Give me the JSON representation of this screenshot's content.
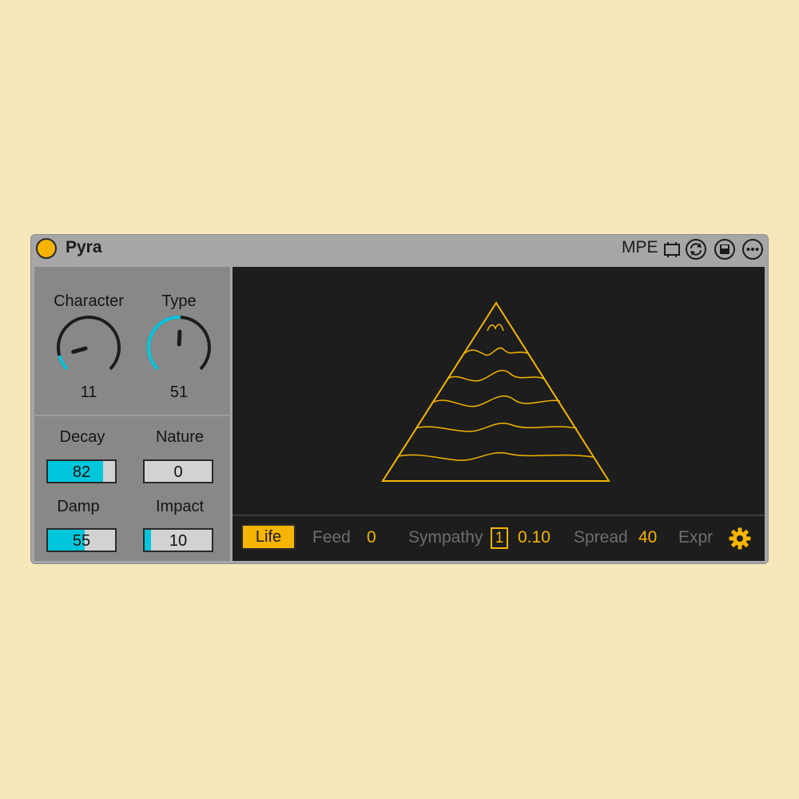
{
  "device": {
    "title": "Pyra",
    "mpe_label": "MPE",
    "header_icons": [
      "mpe-settings-icon",
      "hot-swap-icon",
      "save-icon",
      "more-icon"
    ]
  },
  "colors": {
    "accent": "#f5b400",
    "cyan": "#00c6dc",
    "panel": "#888888",
    "display_bg": "#1d1d1d"
  },
  "knobs": {
    "character": {
      "label": "Character",
      "value": "11",
      "level": 0.11
    },
    "type": {
      "label": "Type",
      "value": "51",
      "level": 0.51
    }
  },
  "params": {
    "decay": {
      "label": "Decay",
      "value": "82",
      "fill": 0.82
    },
    "nature": {
      "label": "Nature",
      "value": "0",
      "fill": 0.0
    },
    "damp": {
      "label": "Damp",
      "value": "55",
      "fill": 0.55
    },
    "impact": {
      "label": "Impact",
      "value": "10",
      "fill": 0.1
    }
  },
  "bottom": {
    "life_label": "Life",
    "feed_label": "Feed",
    "feed_value": "0",
    "sympathy_label": "Sympathy",
    "sympathy_index": "1",
    "sympathy_value": "0.10",
    "spread_label": "Spread",
    "spread_value": "40",
    "expr_label": "Expr",
    "gear_icon": "gear-icon"
  }
}
